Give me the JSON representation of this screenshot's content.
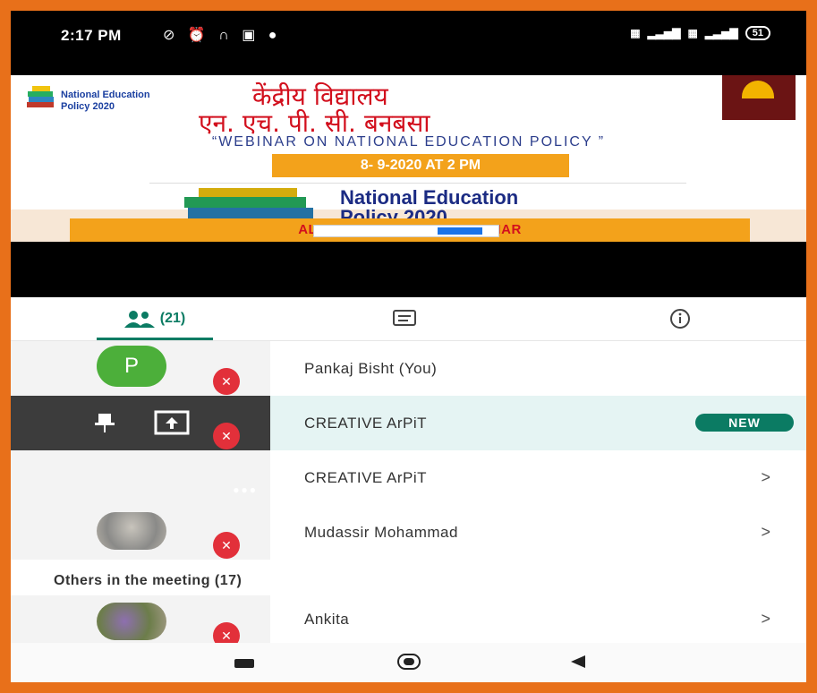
{
  "status": {
    "time": "2:17 PM",
    "icons": [
      "silent-icon",
      "alarm-icon",
      "headphones-icon",
      "app-icon",
      "location-icon"
    ],
    "battery": "51"
  },
  "banner": {
    "nep_logo_text": "National Education Policy 2020",
    "hindi_line1": "केंद्रीय विद्यालय",
    "hindi_line2": "एन. एच. पी. सी. बनबसा",
    "webinar_title": "“WEBINAR ON NATIONAL EDUCATION POLICY ”",
    "date": "8- 9-2020 AT 2 PM",
    "nep_title_line1": "National Education",
    "nep_title_line2": "Policy 2020",
    "staff_text": "ALL STAFF ME                          TED IN WEBINAR"
  },
  "tabs": {
    "people_count": "(21)"
  },
  "participants": [
    {
      "name": "Pankaj Bisht (You)",
      "avatar_letter": "P"
    },
    {
      "name": "CREATIVE ArPiT",
      "badge": "NEW"
    },
    {
      "name": "CREATIVE ArPiT",
      "chevron": ">"
    },
    {
      "name": "Mudassir Mohammad",
      "chevron": ">"
    }
  ],
  "others": {
    "heading": "Others in the meeting (17)",
    "items": [
      {
        "name": "Ankita",
        "chevron": ">"
      }
    ]
  },
  "colors": {
    "frame": "#e8701a",
    "accent": "#0b7b63",
    "mute": "#e2303a"
  }
}
